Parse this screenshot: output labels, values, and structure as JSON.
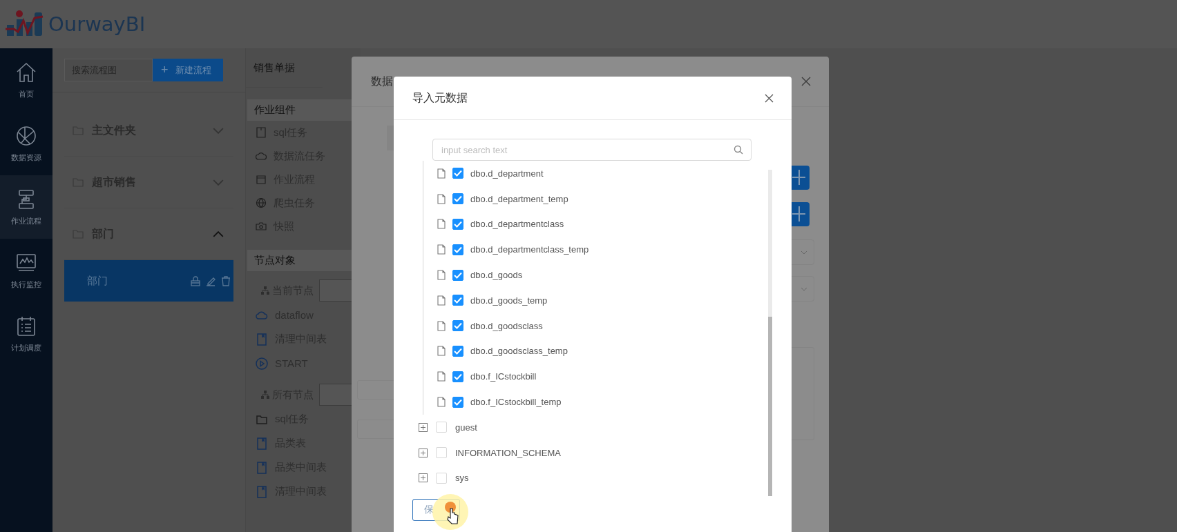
{
  "app": {
    "logo_text": "OurwayBI"
  },
  "nav": [
    {
      "label": "首页",
      "selected": false
    },
    {
      "label": "数据资源",
      "selected": false
    },
    {
      "label": "作业流程",
      "selected": true
    },
    {
      "label": "执行监控",
      "selected": false
    },
    {
      "label": "计划调度",
      "selected": false
    }
  ],
  "file_panel": {
    "search": {
      "placeholder": "搜索流程图"
    },
    "new_button": {
      "icon_text": "+",
      "label": "新建流程"
    },
    "folders": [
      {
        "label": "主文件夹",
        "expanded": false
      },
      {
        "label": "超市销售",
        "expanded": false
      },
      {
        "label": "部门",
        "expanded": true,
        "children": [
          {
            "label": "部门",
            "selected": true
          }
        ]
      }
    ]
  },
  "component_panel": {
    "tab": "销售单据",
    "sections": [
      {
        "title": "作业组件",
        "items": [
          {
            "label": "sql任务"
          },
          {
            "label": "数据流任务"
          },
          {
            "label": "作业流程"
          },
          {
            "label": "爬虫任务"
          },
          {
            "label": "快照"
          }
        ]
      },
      {
        "title": "节点对象",
        "groups": [
          {
            "title": "当前节点",
            "items": [
              {
                "label": "dataflow",
                "kind": "dataflow"
              },
              {
                "label": "清理中间表",
                "kind": "table"
              },
              {
                "label": "START",
                "kind": "start"
              }
            ]
          },
          {
            "title": "所有节点",
            "items": [
              {
                "label": "sql任务",
                "kind": "folder"
              },
              {
                "label": "品类表",
                "kind": "table"
              },
              {
                "label": "品类中间表",
                "kind": "table"
              },
              {
                "label": "清理中间表",
                "kind": "table"
              }
            ]
          }
        ]
      }
    ]
  },
  "back_dialog": {
    "title": "数据"
  },
  "dialog": {
    "title": "导入元数据",
    "search": {
      "placeholder": "input search text"
    },
    "tree": [
      {
        "children": [
          {
            "label": "dbo.d_department",
            "checked": true
          },
          {
            "label": "dbo.d_department_temp",
            "checked": true
          },
          {
            "label": "dbo.d_departmentclass",
            "checked": true
          },
          {
            "label": "dbo.d_departmentclass_temp",
            "checked": true
          },
          {
            "label": "dbo.d_goods",
            "checked": true
          },
          {
            "label": "dbo.d_goods_temp",
            "checked": true
          },
          {
            "label": "dbo.d_goodsclass",
            "checked": true
          },
          {
            "label": "dbo.d_goodsclass_temp",
            "checked": true
          },
          {
            "label": "dbo.f_ICstockbill",
            "checked": true
          },
          {
            "label": "dbo.f_ICstockbill_temp",
            "checked": true
          }
        ]
      },
      {
        "label": "guest",
        "checked": false,
        "expanded": false
      },
      {
        "label": "INFORMATION_SCHEMA",
        "checked": false,
        "expanded": false
      },
      {
        "label": "sys",
        "checked": false,
        "expanded": false
      }
    ],
    "save_button": {
      "label": "保"
    }
  }
}
